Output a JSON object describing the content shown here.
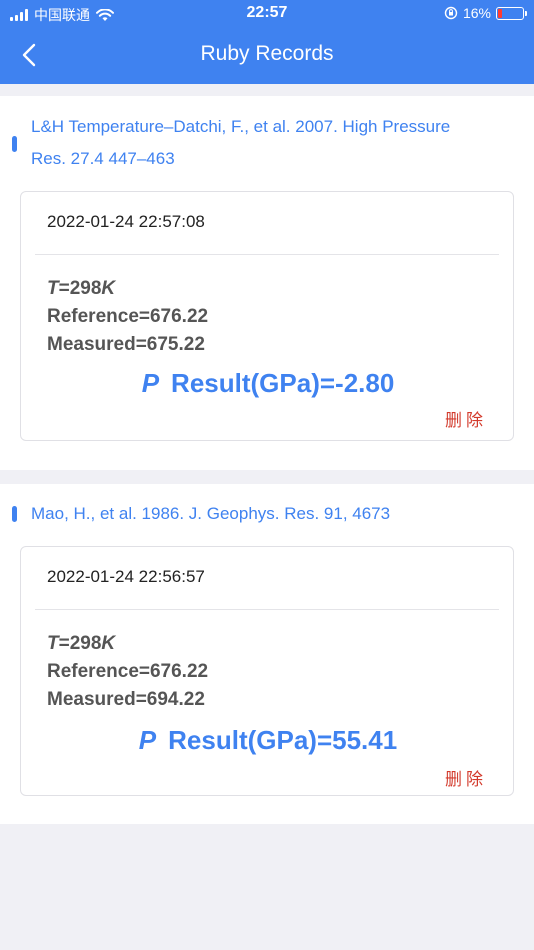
{
  "status_bar": {
    "carrier": "中国联通",
    "time": "22:57",
    "battery": "16%"
  },
  "nav": {
    "title": "Ruby Records"
  },
  "records": [
    {
      "reference_line1": "L&H Temperature–Datchi, F., et al. 2007. High Pressure",
      "reference_line2": "Res. 27.4 447–463",
      "timestamp": "2022-01-24 22:57:08",
      "t_label": "T",
      "t_value": "=298",
      "t_unit": "K",
      "reference": "Reference=676.22",
      "measured": "Measured=675.22",
      "p_label": "P",
      "result": "Result(GPa)=-2.80",
      "delete_label": "删除"
    },
    {
      "reference_line1": "Mao, H., et al. 1986. J. Geophys. Res. 91, 4673",
      "timestamp": "2022-01-24 22:56:57",
      "t_label": "T",
      "t_value": "=298",
      "t_unit": "K",
      "reference": "Reference=676.22",
      "measured": "Measured=694.22",
      "p_label": "P",
      "result": "Result(GPa)=55.41",
      "delete_label": "删除"
    }
  ],
  "colors": {
    "primary": "#3f82f0",
    "delete": "#d33a2c",
    "background": "#f0f0f5"
  }
}
